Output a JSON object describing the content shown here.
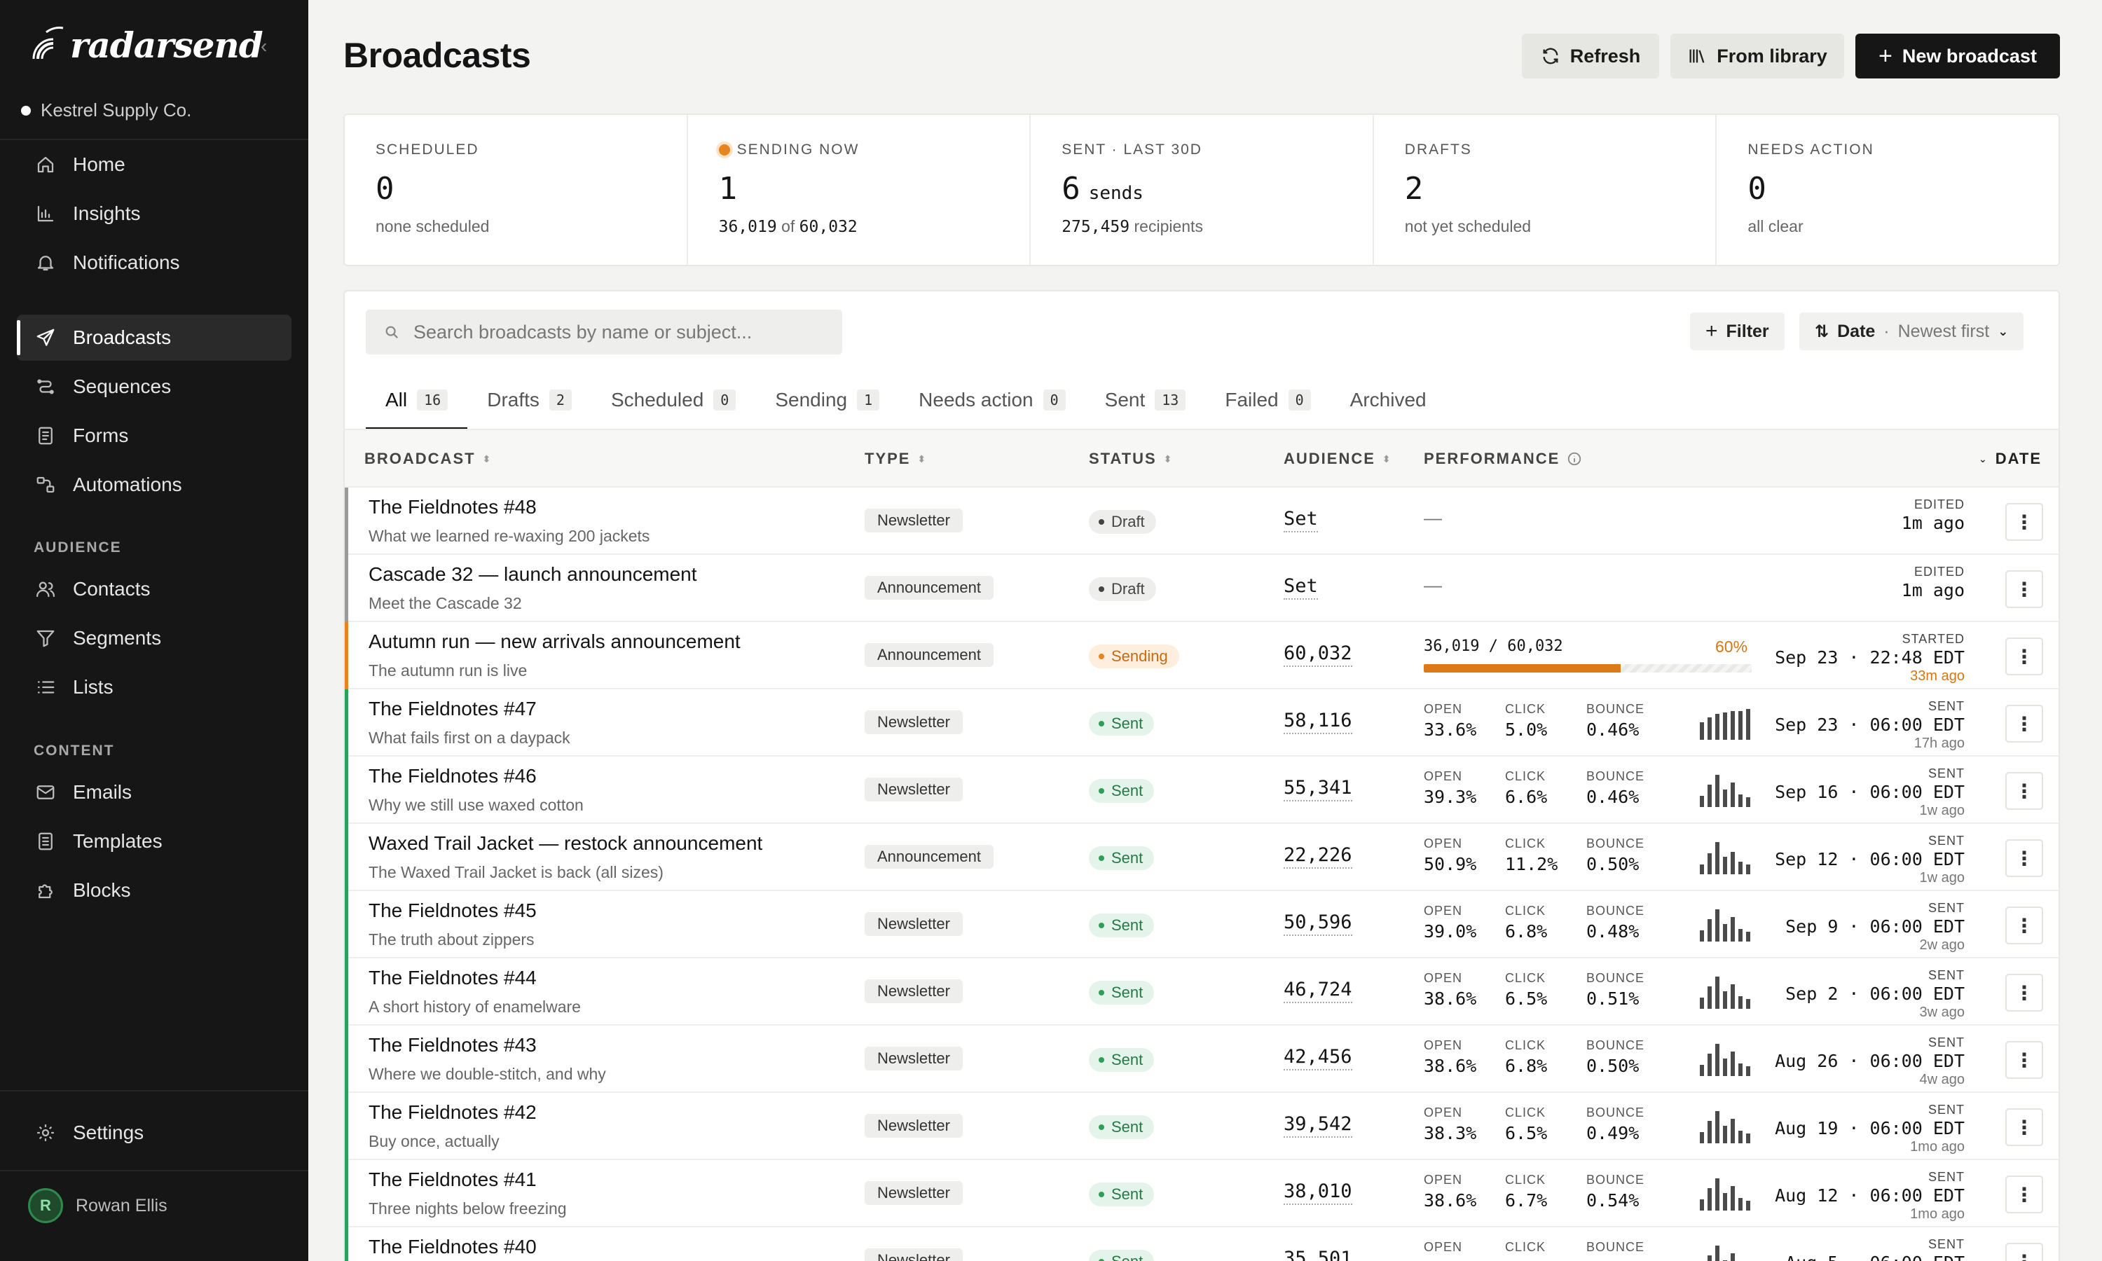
{
  "app": {
    "brand": "radarsend",
    "workspace": "Kestrel Supply Co.",
    "user_name": "Rowan Ellis",
    "user_initial": "R"
  },
  "sidebar": {
    "main": [
      {
        "label": "Home",
        "icon": "home-icon"
      },
      {
        "label": "Insights",
        "icon": "chart-icon"
      },
      {
        "label": "Notifications",
        "icon": "bell-icon"
      }
    ],
    "messaging": [
      {
        "label": "Broadcasts",
        "icon": "send-icon",
        "active": true
      },
      {
        "label": "Sequences",
        "icon": "sequence-icon"
      },
      {
        "label": "Forms",
        "icon": "form-icon"
      },
      {
        "label": "Automations",
        "icon": "automation-icon"
      }
    ],
    "audience_header": "AUDIENCE",
    "audience": [
      {
        "label": "Contacts",
        "icon": "contacts-icon"
      },
      {
        "label": "Segments",
        "icon": "funnel-icon"
      },
      {
        "label": "Lists",
        "icon": "list-icon"
      }
    ],
    "content_header": "CONTENT",
    "content": [
      {
        "label": "Emails",
        "icon": "mail-icon"
      },
      {
        "label": "Templates",
        "icon": "template-icon"
      },
      {
        "label": "Blocks",
        "icon": "puzzle-icon"
      }
    ],
    "settings": "Settings"
  },
  "header": {
    "title": "Broadcasts",
    "refresh": "Refresh",
    "from_library": "From library",
    "new_broadcast": "New broadcast"
  },
  "stats": [
    {
      "label": "SCHEDULED",
      "value": "0",
      "unit": "",
      "sub_strong": "",
      "sub": "none scheduled"
    },
    {
      "label": "SENDING NOW",
      "value": "1",
      "unit": "",
      "sub_strong": "36,019",
      "sub": " of ",
      "sub_strong2": "60,032"
    },
    {
      "label": "SENT · LAST 30D",
      "value": "6",
      "unit": "sends",
      "sub_strong": "275,459",
      "sub": " recipients"
    },
    {
      "label": "DRAFTS",
      "value": "2",
      "unit": "",
      "sub_strong": "",
      "sub": "not yet scheduled"
    },
    {
      "label": "NEEDS ACTION",
      "value": "0",
      "unit": "",
      "sub_strong": "",
      "sub": "all clear"
    }
  ],
  "toolbar": {
    "search_placeholder": "Search broadcasts by name or subject...",
    "filter": "Filter",
    "sort_label": "Date",
    "sort_value": "Newest first"
  },
  "tabs": [
    {
      "label": "All",
      "count": "16",
      "active": true
    },
    {
      "label": "Drafts",
      "count": "2"
    },
    {
      "label": "Scheduled",
      "count": "0"
    },
    {
      "label": "Sending",
      "count": "1"
    },
    {
      "label": "Needs action",
      "count": "0"
    },
    {
      "label": "Sent",
      "count": "13"
    },
    {
      "label": "Failed",
      "count": "0"
    },
    {
      "label": "Archived",
      "count": ""
    }
  ],
  "columns": {
    "broadcast": "BROADCAST",
    "type": "TYPE",
    "status": "STATUS",
    "audience": "AUDIENCE",
    "performance": "PERFORMANCE",
    "date": "DATE"
  },
  "metric_labels": {
    "open": "OPEN",
    "click": "CLICK",
    "bounce": "BOUNCE"
  },
  "colors": {
    "draft": "#9a9a9a",
    "sending": "#e8841d",
    "sent": "#2e9e5b"
  },
  "rows": [
    {
      "title": "The Fieldnotes #48",
      "subtitle": "What we learned re-waxing 200 jackets",
      "type": "Newsletter",
      "status": "Draft",
      "audience": "Set",
      "date_label": "EDITED",
      "date": "1m ago",
      "rel": ""
    },
    {
      "title": "Cascade 32 — launch announcement",
      "subtitle": "Meet the Cascade 32",
      "type": "Announcement",
      "status": "Draft",
      "audience": "Set",
      "date_label": "EDITED",
      "date": "1m ago",
      "rel": ""
    },
    {
      "title": "Autumn run — new arrivals announcement",
      "subtitle": "The autumn run is live",
      "type": "Announcement",
      "status": "Sending",
      "audience": "60,032",
      "progress_text": "36,019 / 60,032",
      "progress_pct": "60%",
      "progress": 0.6,
      "date_label": "STARTED",
      "date": "Sep 23 · 22:48 EDT",
      "rel": "33m ago"
    },
    {
      "title": "The Fieldnotes #47",
      "subtitle": "What fails first on a daypack",
      "type": "Newsletter",
      "status": "Sent",
      "audience": "58,116",
      "open": "33.6%",
      "click": "5.0%",
      "bounce": "0.46%",
      "spark": [
        0.55,
        0.7,
        0.8,
        0.85,
        0.9,
        0.9,
        0.95
      ],
      "date_label": "SENT",
      "date": "Sep 23 · 06:00 EDT",
      "rel": "17h ago"
    },
    {
      "title": "The Fieldnotes #46",
      "subtitle": "Why we still use waxed cotton",
      "type": "Newsletter",
      "status": "Sent",
      "audience": "55,341",
      "open": "39.3%",
      "click": "6.6%",
      "bounce": "0.46%",
      "spark": [
        0.35,
        0.7,
        1.0,
        0.55,
        0.75,
        0.4,
        0.3
      ],
      "date_label": "SENT",
      "date": "Sep 16 · 06:00 EDT",
      "rel": "1w ago"
    },
    {
      "title": "Waxed Trail Jacket — restock announcement",
      "subtitle": "The Waxed Trail Jacket is back (all sizes)",
      "type": "Announcement",
      "status": "Sent",
      "audience": "22,226",
      "open": "50.9%",
      "click": "11.2%",
      "bounce": "0.50%",
      "spark": [
        0.3,
        0.65,
        1.0,
        0.55,
        0.7,
        0.4,
        0.3
      ],
      "date_label": "SENT",
      "date": "Sep 12 · 06:00 EDT",
      "rel": "1w ago"
    },
    {
      "title": "The Fieldnotes #45",
      "subtitle": "The truth about zippers",
      "type": "Newsletter",
      "status": "Sent",
      "audience": "50,596",
      "open": "39.0%",
      "click": "6.8%",
      "bounce": "0.48%",
      "spark": [
        0.35,
        0.7,
        1.0,
        0.55,
        0.75,
        0.4,
        0.3
      ],
      "date_label": "SENT",
      "date": "Sep 9 · 06:00 EDT",
      "rel": "2w ago"
    },
    {
      "title": "The Fieldnotes #44",
      "subtitle": "A short history of enamelware",
      "type": "Newsletter",
      "status": "Sent",
      "audience": "46,724",
      "open": "38.6%",
      "click": "6.5%",
      "bounce": "0.51%",
      "spark": [
        0.35,
        0.7,
        1.0,
        0.55,
        0.75,
        0.4,
        0.3
      ],
      "date_label": "SENT",
      "date": "Sep 2 · 06:00 EDT",
      "rel": "3w ago"
    },
    {
      "title": "The Fieldnotes #43",
      "subtitle": "Where we double-stitch, and why",
      "type": "Newsletter",
      "status": "Sent",
      "audience": "42,456",
      "open": "38.6%",
      "click": "6.8%",
      "bounce": "0.50%",
      "spark": [
        0.35,
        0.7,
        1.0,
        0.55,
        0.75,
        0.4,
        0.3
      ],
      "date_label": "SENT",
      "date": "Aug 26 · 06:00 EDT",
      "rel": "4w ago"
    },
    {
      "title": "The Fieldnotes #42",
      "subtitle": "Buy once, actually",
      "type": "Newsletter",
      "status": "Sent",
      "audience": "39,542",
      "open": "38.3%",
      "click": "6.5%",
      "bounce": "0.49%",
      "spark": [
        0.35,
        0.7,
        1.0,
        0.55,
        0.75,
        0.4,
        0.3
      ],
      "date_label": "SENT",
      "date": "Aug 19 · 06:00 EDT",
      "rel": "1mo ago"
    },
    {
      "title": "The Fieldnotes #41",
      "subtitle": "Three nights below freezing",
      "type": "Newsletter",
      "status": "Sent",
      "audience": "38,010",
      "open": "38.6%",
      "click": "6.7%",
      "bounce": "0.54%",
      "spark": [
        0.35,
        0.7,
        1.0,
        0.55,
        0.75,
        0.4,
        0.3
      ],
      "date_label": "SENT",
      "date": "Aug 12 · 06:00 EDT",
      "rel": "1mo ago"
    },
    {
      "title": "The Fieldnotes #40",
      "subtitle": "",
      "type": "Newsletter",
      "status": "Sent",
      "audience": "35,501",
      "open": "",
      "click": "",
      "bounce": "",
      "spark": [
        0.35,
        0.7,
        1.0,
        0.55,
        0.75,
        0.4,
        0.3
      ],
      "date_label": "SENT",
      "date": "Aug 5 · 06:00 EDT",
      "rel": ""
    }
  ]
}
